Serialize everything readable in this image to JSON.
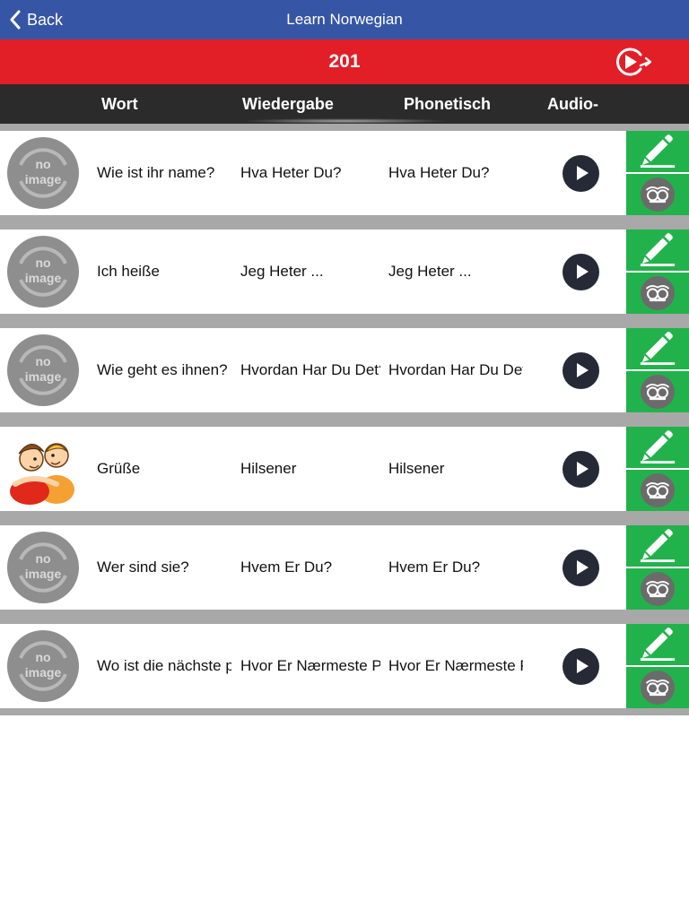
{
  "navbar": {
    "back_label": "Back",
    "title": "Learn Norwegian"
  },
  "lesson": {
    "number": "201"
  },
  "columns": {
    "word": "Wort",
    "translation": "Wiedergabe",
    "phonetic": "Phonetisch",
    "audio": "Audio-"
  },
  "no_image": {
    "line1": "no",
    "line2": "image"
  },
  "rows": [
    {
      "word": "Wie ist ihr name?",
      "translation": "Hva Heter Du?",
      "phonetic": "Hva Heter Du?",
      "image": "no-image"
    },
    {
      "word": "Ich heiße",
      "translation": "Jeg Heter ...",
      "phonetic": "Jeg Heter ...",
      "image": "no-image"
    },
    {
      "word": "Wie geht es ihnen?",
      "translation": "Hvordan Har Du Det?",
      "phonetic": "Hvordan Har Du Det?",
      "image": "no-image"
    },
    {
      "word": "Grüße",
      "translation": "Hilsener",
      "phonetic": "Hilsener",
      "image": "greeting-people-picture"
    },
    {
      "word": "Wer sind sie?",
      "translation": "Hvem Er Du?",
      "phonetic": "Hvem Er Du?",
      "image": "no-image"
    },
    {
      "word": "Wo ist die nächste post?",
      "translation": "Hvor Er Nærmeste Post?",
      "phonetic": "Hvor Er Nærmeste Post?",
      "image": "no-image"
    }
  ],
  "colors": {
    "navbar": "#3656a5",
    "lesson_bar": "#e21e27",
    "header": "#2b2b2b",
    "action_green": "#22b24c",
    "separator": "#a8a8a8",
    "play_button": "#252a36"
  }
}
